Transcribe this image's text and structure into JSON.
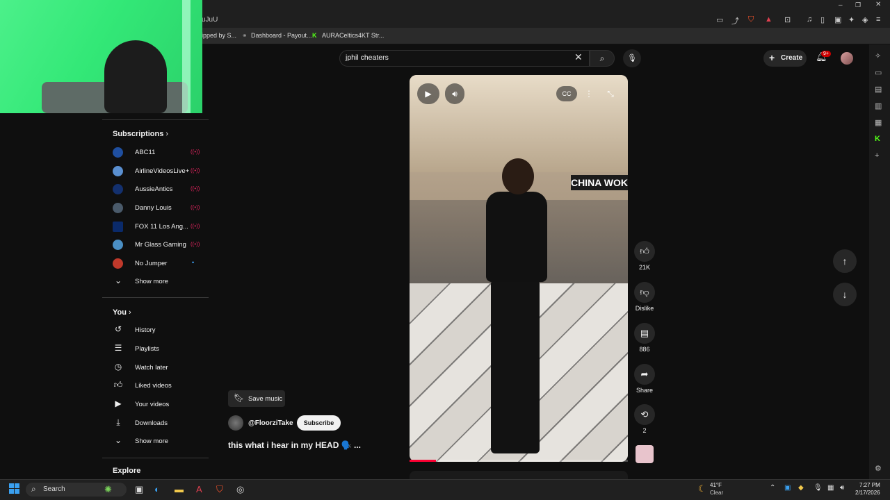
{
  "browser": {
    "url_fragment": "uJuU",
    "bookmarks": [
      "ipped by S...",
      "Dashboard - Payout...",
      "AURACeltics4KT Str..."
    ]
  },
  "header": {
    "search_value": "jphil cheaters",
    "create_label": "Create",
    "notification_badge": "9+"
  },
  "sidebar": {
    "subscriptions_title": "Subscriptions",
    "subscriptions": [
      {
        "name": "ABC11",
        "color": "#1f4fa0",
        "status": "live"
      },
      {
        "name": "AirlineVideosLive+",
        "color": "#5a8fd0",
        "status": "live"
      },
      {
        "name": "AussieAntics",
        "color": "#13306e",
        "status": "live"
      },
      {
        "name": "Danny Louis",
        "color": "#4a5a6a",
        "status": "live"
      },
      {
        "name": "FOX 11 Los Ang...",
        "color": "#0a2a6a",
        "status": "live"
      },
      {
        "name": "Mr Glass Gaming",
        "color": "#4b8fc4",
        "status": "live"
      },
      {
        "name": "No Jumper",
        "color": "#c0392b",
        "status": "new"
      }
    ],
    "show_more_1": "Show more",
    "you_title": "You",
    "you_items": [
      "History",
      "Playlists",
      "Watch later",
      "Liked videos",
      "Your videos",
      "Downloads"
    ],
    "show_more_2": "Show more",
    "explore_title": "Explore"
  },
  "video": {
    "store_sign": "CHINA WOK",
    "save_music_label": "Save music",
    "channel_name": "@FloorziTake",
    "subscribe_label": "Subscribe",
    "caption": "this what i hear in my HEAD 🗣️ ...",
    "progress": 0.12
  },
  "actions": {
    "likes": "21K",
    "dislike_label": "Dislike",
    "comments": "886",
    "share_label": "Share",
    "remix_count": "2"
  },
  "taskbar": {
    "search_label": "Search",
    "weather_temp": "41°F",
    "weather_desc": "Clear",
    "time": "7:27 PM",
    "date": "2/17/2026"
  }
}
